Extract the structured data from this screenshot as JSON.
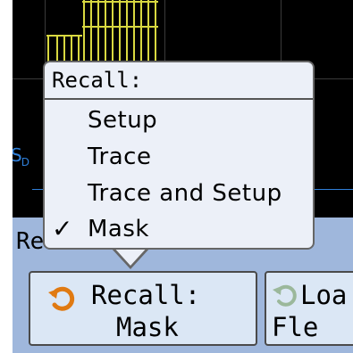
{
  "display": {
    "bus_label": "S",
    "bus_label_sub": "D"
  },
  "softkey_bar": {
    "title": "Re",
    "recall_key": {
      "line1": "Recall:",
      "line2": "Mask",
      "icon": "recall-arrow-icon"
    },
    "load_key": {
      "line1": "Loa",
      "line2": "Fle",
      "icon": "load-arrow-icon"
    }
  },
  "popup": {
    "title": "Recall:",
    "items": [
      {
        "label": "Setup",
        "checked": false
      },
      {
        "label": "Trace",
        "checked": false
      },
      {
        "label": "Trace and Setup",
        "checked": false
      },
      {
        "label": "Mask",
        "checked": true
      }
    ],
    "check_glyph": "✓"
  },
  "colors": {
    "screen": "#000000",
    "softkey_bar": "#9fb7dc",
    "softkey_face": "#dbe7f5",
    "popup_bg": "#ecf0f8",
    "waveform": "#d8d840",
    "bus": "#2f7fd8",
    "icon_orange": "#e07a12"
  }
}
